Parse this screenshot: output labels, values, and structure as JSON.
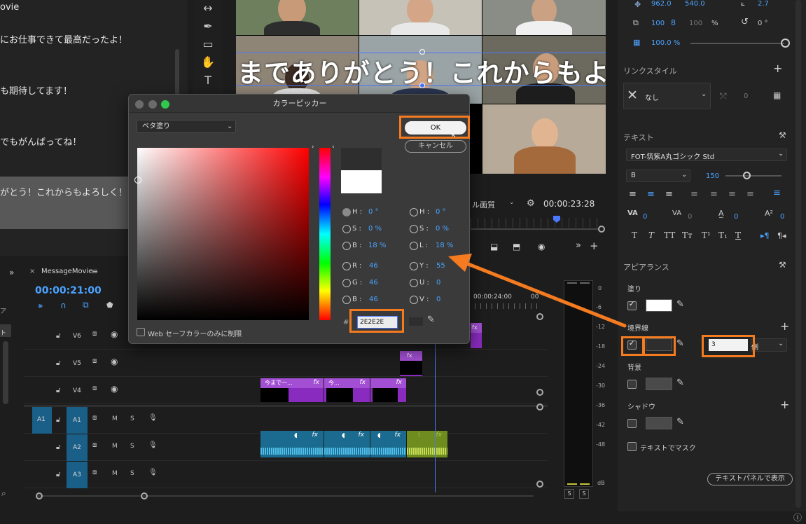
{
  "left_panel": {
    "lines": [
      "ovie",
      "にお仕事できて最高だったよ！",
      "も期待してます！",
      "でもがんばってね！",
      "がとう！これからもよろしく！"
    ]
  },
  "video": {
    "overlay_text": "までありがとう！これからもよろし"
  },
  "monitor": {
    "quality": "ル画質",
    "timecode": "00:00:23:28"
  },
  "timeline": {
    "sequence_name": "MessageMovie",
    "timecode": "00:00:21:00",
    "ruler_label": "00:00:24:00",
    "ruler_label_2": "00",
    "video_tracks": [
      "V6",
      "V5",
      "V4"
    ],
    "audio_tracks": [
      "A1",
      "A2",
      "A3"
    ],
    "source_patch": "A1",
    "track_buttons": {
      "mute": "M",
      "solo": "S"
    },
    "clips": [
      "今まで一...",
      "今...",
      ""
    ],
    "fx": "fx",
    "side_labels": [
      "ア",
      "ト"
    ]
  },
  "meter": {
    "ticks": [
      "0",
      "-6",
      "-12",
      "-18",
      "-24",
      "-30",
      "-36",
      "-42",
      "-48",
      "dB"
    ],
    "solo_buttons": [
      "S",
      "S"
    ]
  },
  "properties": {
    "position_x": "962.0",
    "position_y": "540.0",
    "anchor": "2.7",
    "scale": "100",
    "scale_w": "100",
    "scale_unit": "%",
    "rotation": "0 °",
    "opacity": "100.0 %",
    "link_style_header": "リンクスタイル",
    "link_style_value": "なし",
    "link_style_count": "0",
    "text_header": "テキスト",
    "font_name": "FOT-筑紫A丸ゴシック Std",
    "font_style": "B",
    "font_size": "150",
    "tracking_values": [
      "0",
      "0",
      "0",
      "0"
    ],
    "appearance_header": "アピアランス",
    "fill_label": "塗り",
    "stroke_label": "境界線",
    "stroke_width": "3",
    "stroke_position": "側",
    "background_label": "背景",
    "shadow_label": "シャドウ",
    "mask_label": "テキストでマスク",
    "show_in_panel_button": "テキストパネルで表示"
  },
  "color_picker": {
    "title": "カラーピッカー",
    "fill_type": "ベタ塗り",
    "ok_label": "OK",
    "cancel_label": "キャンセル",
    "hsb": [
      {
        "label": "H :",
        "value": "0 °",
        "selected": true
      },
      {
        "label": "S :",
        "value": "0 %",
        "selected": false
      },
      {
        "label": "B :",
        "value": "18 %",
        "selected": false
      }
    ],
    "hsl": [
      {
        "label": "H :",
        "value": "0 °"
      },
      {
        "label": "S :",
        "value": "0 %"
      },
      {
        "label": "L :",
        "value": "18 %"
      }
    ],
    "rgb": [
      {
        "label": "R :",
        "value": "46"
      },
      {
        "label": "G :",
        "value": "46"
      },
      {
        "label": "B :",
        "value": "46"
      }
    ],
    "yuv": [
      {
        "label": "Y :",
        "value": "55"
      },
      {
        "label": "U :",
        "value": "0"
      },
      {
        "label": "V :",
        "value": "0"
      }
    ],
    "hex_label": "#",
    "hex_value": "2E2E2E",
    "websafe_label": "Web セーフカラーのみに制限",
    "new_color": "#2E2E2E",
    "old_color": "#FFFFFF"
  },
  "colors": {
    "accent_orange": "#F47B20",
    "selection_blue": "#4A78FF",
    "value_blue": "#4AA3FF",
    "video_clip": "#8A2BBF",
    "audio_clip": "#1B6A8F",
    "audio_clip_alt": "#6F8C1E"
  }
}
